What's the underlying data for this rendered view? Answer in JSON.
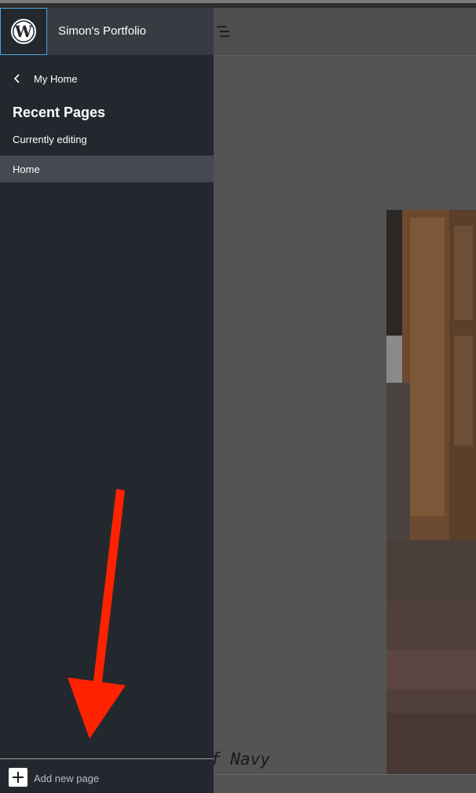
{
  "site": {
    "title": "Simon's Portfolio"
  },
  "sidebar": {
    "back_label": "My Home",
    "section_title": "Recent Pages",
    "section_subtitle": "Currently editing",
    "pages": [
      {
        "label": "Home"
      }
    ],
    "add_label": "Add new page"
  },
  "canvas": {
    "text_fragment": "f Navy"
  },
  "annotation": {
    "arrow_color": "#ff2200"
  },
  "icons": {
    "logo": "wordpress-logo-icon",
    "back": "chevron-left-icon",
    "list_view": "list-view-icon",
    "add": "plus-icon"
  }
}
